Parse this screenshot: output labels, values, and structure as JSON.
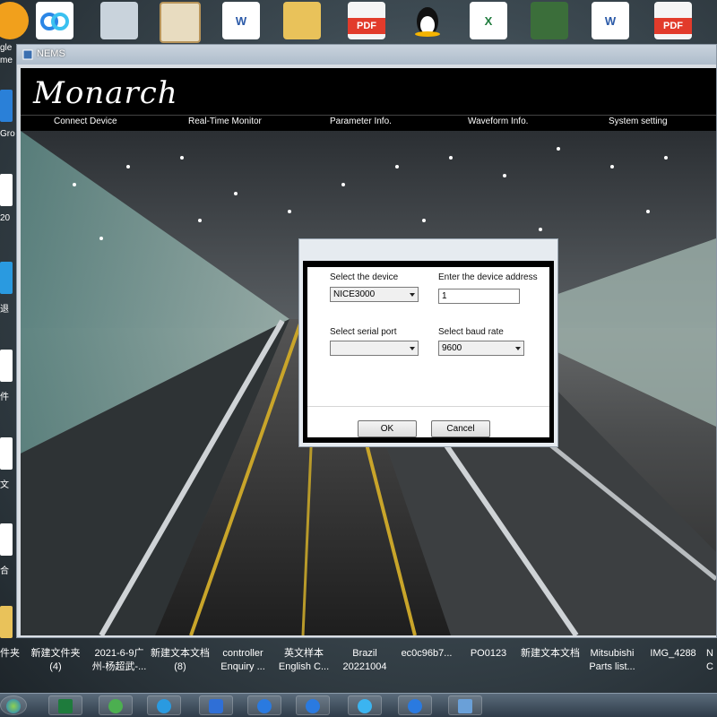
{
  "window": {
    "title": "NEMS"
  },
  "app": {
    "logo": "Monarch",
    "menu": [
      {
        "label": "Connect Device"
      },
      {
        "label": "Real-Time Monitor"
      },
      {
        "label": "Parameter Info."
      },
      {
        "label": "Waveform Info."
      },
      {
        "label": "System setting"
      }
    ]
  },
  "dialog": {
    "device_label": "Select the device",
    "device_value": "NICE3000",
    "address_label": "Enter the device address",
    "address_value": "1",
    "serial_label": "Select serial port",
    "serial_value": "",
    "baud_label": "Select baud rate",
    "baud_value": "9600",
    "ok_label": "OK",
    "cancel_label": "Cancel"
  },
  "desktop": {
    "top_icons": [
      "baidu-netdisk-icon",
      "document-image-icon",
      "certificate-image-icon",
      "word-doc-icon",
      "folder-icon",
      "pdf-icon",
      "qq-penguin-icon",
      "excel-icon",
      "circuit-board-image-icon",
      "word-doc-icon",
      "pdf-icon"
    ],
    "pdf_label": "PDF",
    "left_edge_text": [
      "gle",
      "me",
      "Gro",
      "20",
      "退",
      "件",
      "文",
      "合",
      "件夹"
    ],
    "bottom_labels": [
      {
        "line1": "件夹",
        "line2": ""
      },
      {
        "line1": "新建文件夹",
        "line2": "(4)"
      },
      {
        "line1": "2021-6-9广",
        "line2": "州-杨超武-..."
      },
      {
        "line1": "新建文本文档",
        "line2": "(8)"
      },
      {
        "line1": "controller",
        "line2": "Enquiry ..."
      },
      {
        "line1": "英文样本",
        "line2": "English C..."
      },
      {
        "line1": "Brazil",
        "line2": "20221004"
      },
      {
        "line1": "ec0c96b7...",
        "line2": ""
      },
      {
        "line1": "PO0123",
        "line2": ""
      },
      {
        "line1": "新建文本文档",
        "line2": ""
      },
      {
        "line1": "Mitsubishi",
        "line2": "Parts list..."
      },
      {
        "line1": "IMG_4288",
        "line2": ""
      },
      {
        "line1": "N",
        "line2": "C"
      }
    ]
  },
  "taskbar": {
    "items": [
      "start-orb-icon",
      "excel-icon",
      "refresh-icon",
      "ie-browser-icon",
      "safety-shield-icon",
      "sogou-icon",
      "sogou-icon",
      "water-drop-icon",
      "sogou-icon",
      "window-switch-icon"
    ]
  },
  "colors": {
    "title_bar": "#aebccb",
    "app_background": "#000000",
    "menu_text": "#ffffff",
    "dialog_frame": "#e6ebf0"
  }
}
